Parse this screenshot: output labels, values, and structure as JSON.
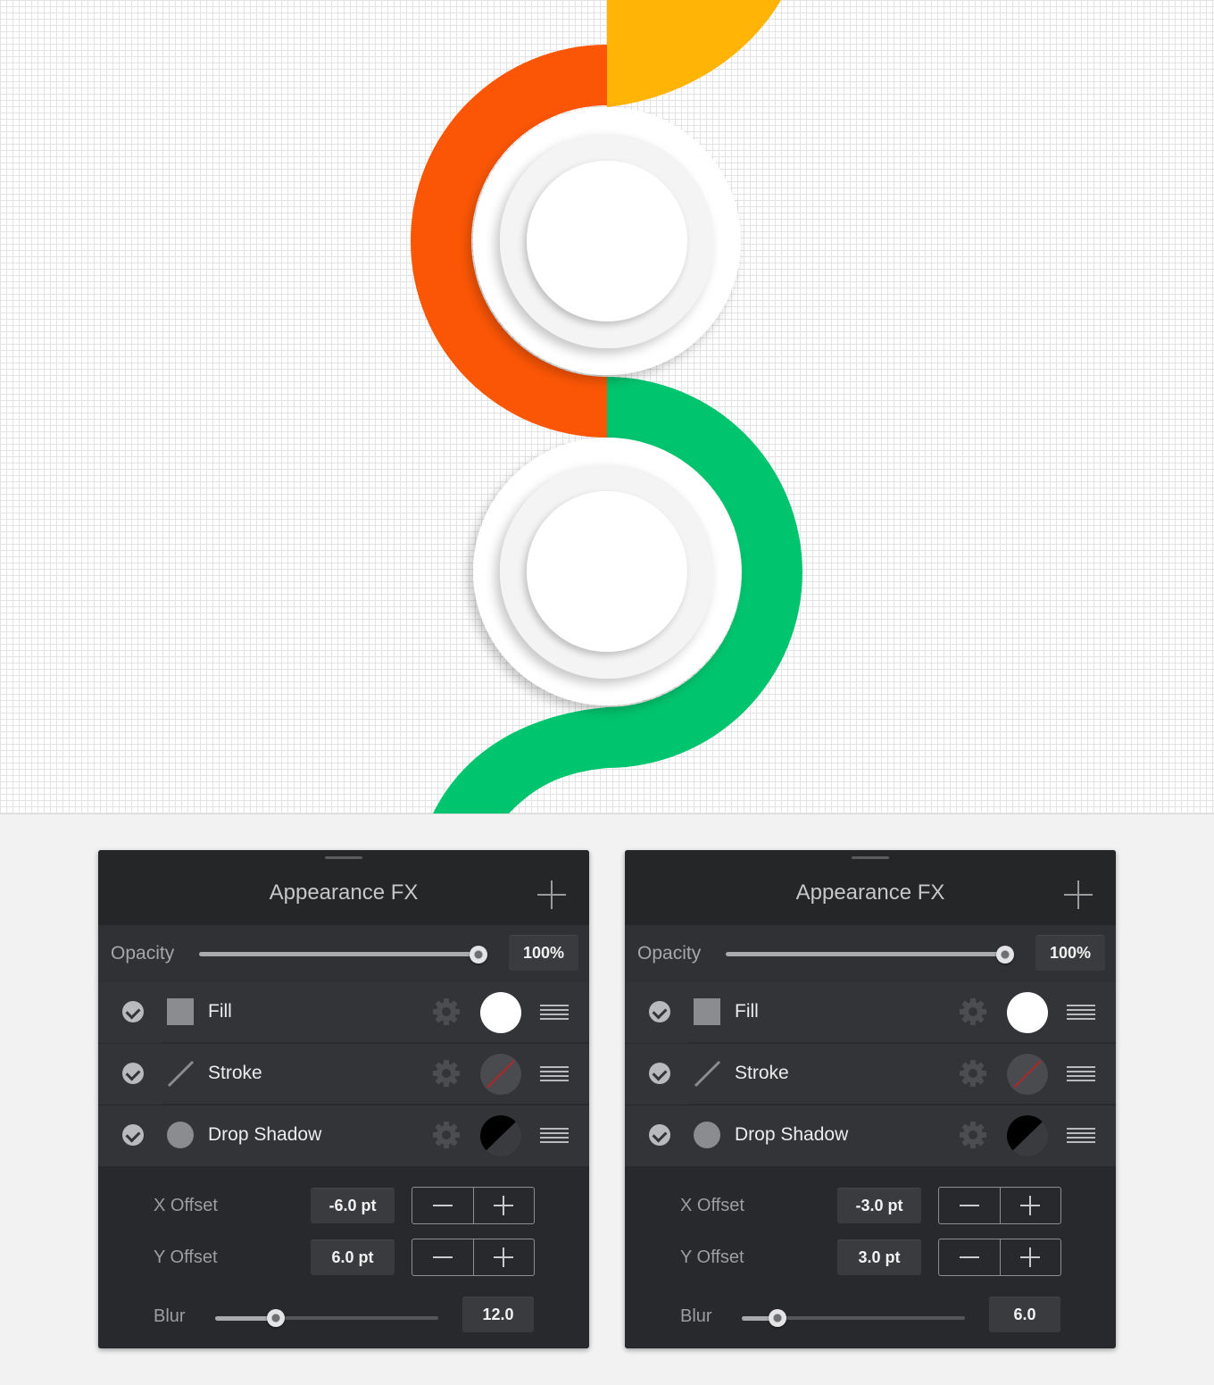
{
  "artwork": {
    "colors": {
      "orange": "#fb5605",
      "yellow": "#ffb406",
      "green": "#01c46e",
      "disc": "#ffffff"
    }
  },
  "panels": [
    {
      "title": "Appearance FX",
      "add_icon": "plus-icon",
      "opacity": {
        "label": "Opacity",
        "value_text": "100%",
        "level": 1.0
      },
      "effects": [
        {
          "label": "Fill",
          "icon": "fill-square-icon",
          "swatch": "white",
          "enabled": true
        },
        {
          "label": "Stroke",
          "icon": "stroke-line-icon",
          "swatch": "none",
          "enabled": true
        },
        {
          "label": "Drop Shadow",
          "icon": "shadow-circle-icon",
          "swatch": "black",
          "enabled": true
        }
      ],
      "x_offset": {
        "label": "X Offset",
        "value": "-6.0 pt"
      },
      "y_offset": {
        "label": "Y Offset",
        "value": "6.0 pt"
      },
      "blur": {
        "label": "Blur",
        "value": "12.0",
        "level": 0.27
      }
    },
    {
      "title": "Appearance FX",
      "add_icon": "plus-icon",
      "opacity": {
        "label": "Opacity",
        "value_text": "100%",
        "level": 1.0
      },
      "effects": [
        {
          "label": "Fill",
          "icon": "fill-square-icon",
          "swatch": "white",
          "enabled": true
        },
        {
          "label": "Stroke",
          "icon": "stroke-line-icon",
          "swatch": "none",
          "enabled": true
        },
        {
          "label": "Drop Shadow",
          "icon": "shadow-circle-icon",
          "swatch": "black",
          "enabled": true
        }
      ],
      "x_offset": {
        "label": "X Offset",
        "value": "-3.0 pt"
      },
      "y_offset": {
        "label": "Y Offset",
        "value": "3.0 pt"
      },
      "blur": {
        "label": "Blur",
        "value": "6.0",
        "level": 0.16
      }
    }
  ]
}
